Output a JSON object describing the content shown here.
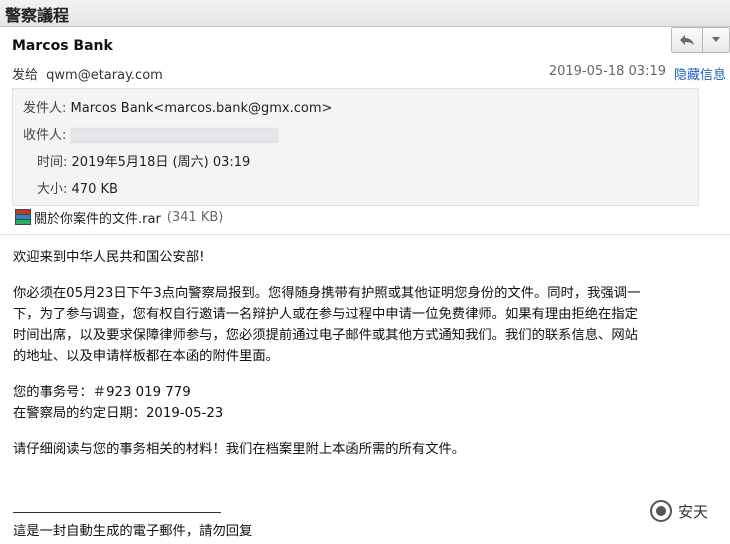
{
  "subject": "警察議程",
  "header": {
    "sender_name": "Marcos Bank",
    "sent_to_label": "发给",
    "sent_to_value": "qwm@etaray.com",
    "datetime": "2019-05-18 03:19",
    "hide_info_label": "隐藏信息",
    "reply_icon": "reply-icon",
    "more_icon": "chevron-down-icon"
  },
  "details": {
    "from_label": "发件人:",
    "from_value": "Marcos Bank<marcos.bank@gmx.com>",
    "to_label": "收件人:",
    "time_label": "时间:",
    "time_value": "2019年5月18日 (周六) 03:19",
    "size_label": "大小:",
    "size_value": "470 KB"
  },
  "attachment": {
    "name": "關於你案件的文件.rar",
    "size": "(341 KB)",
    "icon": "rar-archive-icon"
  },
  "body": {
    "greeting": "欢迎来到中华人民共和国公安部!",
    "para1_line1": "你必须在05月23日下午3点向警察局报到。您得随身携带有护照或其他证明您身份的文件。同时，我强调一",
    "para1_line2": "下，为了参与调查，您有权自行邀请一名辩护人或在参与过程中申请一位免费律师。如果有理由拒绝在指定",
    "para1_line3": "时间出席，以及要求保障律师参与，您必须提前通过电子邮件或其他方式通知我们。我们的联系信息、网站",
    "para1_line4": "的地址、以及申请样板都在本函的附件里面。",
    "case_no": "您的事务号：＃923 019 779",
    "appointment": "在警察局的约定日期：2019-05-23",
    "closing": "请仔细阅读与您的事务相关的材料！我们在档案里附上本函所需的所有文件。",
    "signature": "這是一封自動生成的電子郵件，請勿回复"
  },
  "watermark": {
    "text": "安天"
  }
}
